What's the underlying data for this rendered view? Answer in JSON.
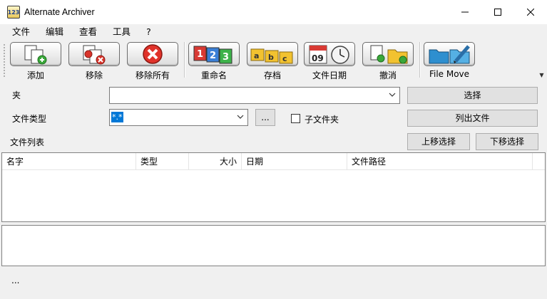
{
  "window": {
    "title": "Alternate Archiver",
    "icon_text": "123"
  },
  "menu": {
    "items": [
      "文件",
      "编辑",
      "查看",
      "工具",
      "?"
    ]
  },
  "toolbar": {
    "buttons": [
      {
        "label": "添加",
        "icon": "add-files-icon"
      },
      {
        "label": "移除",
        "icon": "remove-files-icon"
      },
      {
        "label": "移除所有",
        "icon": "remove-all-icon"
      },
      {
        "label": "重命名",
        "icon": "rename-icon"
      },
      {
        "label": "存档",
        "icon": "archive-icon"
      },
      {
        "label": "文件日期",
        "icon": "file-date-icon"
      },
      {
        "label": "撤消",
        "icon": "undo-icon"
      },
      {
        "label": "File Move",
        "icon": "file-move-icon"
      }
    ],
    "date_icon_day": "09"
  },
  "form": {
    "folder_label": "夹",
    "folder_value": "",
    "select_button": "选择",
    "filetype_label": "文件类型",
    "filetype_value": "*.*",
    "browse_button": "...",
    "subfolder_label": "子文件夹",
    "subfolder_checked": false,
    "list_files_button": "列出文件"
  },
  "file_list": {
    "label": "文件列表",
    "move_up_button": "上移选择",
    "move_down_button": "下移选择",
    "columns": [
      "名字",
      "类型",
      "大小",
      "日期",
      "文件路径"
    ],
    "rows": []
  },
  "status": {
    "text": "..."
  }
}
